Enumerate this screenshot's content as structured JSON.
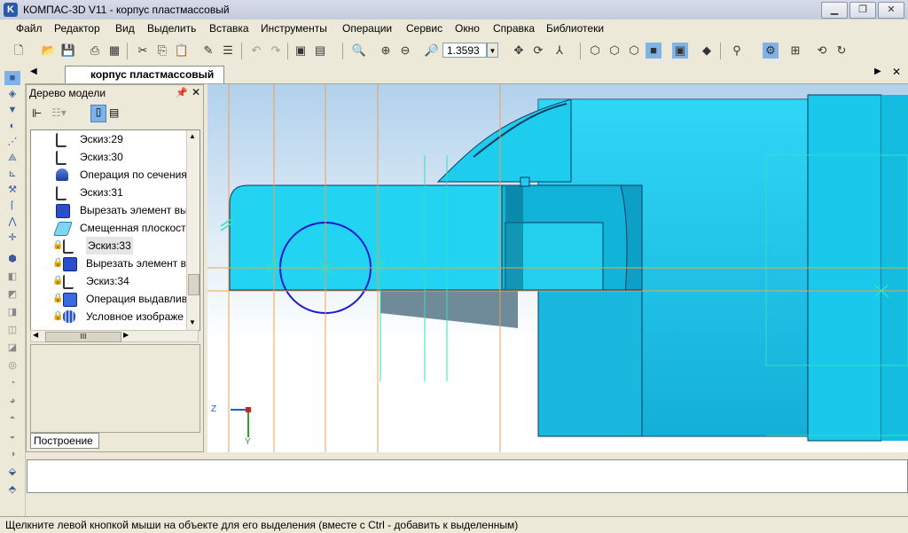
{
  "window": {
    "title": "КОМПАС-3D V11 - корпус пластмассовый",
    "app_icon": "K",
    "controls": [
      "minimize-icon",
      "restore-icon",
      "close-icon"
    ]
  },
  "menu": [
    "Файл",
    "Редактор",
    "Вид",
    "Выделить",
    "Вставка",
    "Инструменты",
    "Операции",
    "Сервис",
    "Окно",
    "Справка",
    "Библиотеки"
  ],
  "toolbar": {
    "zoom_value": "1.3593",
    "icons": [
      "new-document-icon",
      "open-icon",
      "save-icon",
      "print-preview-icon",
      "cut-icon",
      "copy-icon",
      "paste-icon",
      "properties-icon",
      "undo-icon",
      "redo-icon",
      "zoom-icon",
      "rotate-icon",
      "orient-icon",
      "wireframe-icon",
      "shaded-icon"
    ]
  },
  "document_tab": {
    "label": "корпус пластмассовый"
  },
  "tree": {
    "title": "Дерево модели",
    "items": [
      {
        "label": "Эскиз:29",
        "icon": "sketch-icon",
        "locked": false
      },
      {
        "label": "Эскиз:30",
        "icon": "sketch-icon",
        "locked": false
      },
      {
        "label": "Операция по сечения",
        "icon": "loft-icon",
        "locked": false
      },
      {
        "label": "Эскиз:31",
        "icon": "sketch-icon",
        "locked": false
      },
      {
        "label": "Вырезать элемент вы",
        "icon": "cut-extrude-icon",
        "locked": false
      },
      {
        "label": "Смещенная плоскост",
        "icon": "offset-plane-icon",
        "locked": false
      },
      {
        "label": "Эскиз:33",
        "icon": "sketch-icon",
        "locked": true
      },
      {
        "label": "Вырезать элемент в",
        "icon": "cut-extrude-icon",
        "locked": true
      },
      {
        "label": "Эскиз:34",
        "icon": "sketch-icon",
        "locked": true
      },
      {
        "label": "Операция выдавливе",
        "icon": "extrude-icon",
        "locked": true
      },
      {
        "label": "Условное изображе",
        "icon": "thread-icon",
        "locked": true
      }
    ],
    "bottom_tab": "Построение",
    "hscroll_label": "III"
  },
  "axes": {
    "z": "Z",
    "y": "Y"
  },
  "status": {
    "text": "Щелкните левой кнопкой мыши на объекте для его выделения (вместе с Ctrl - добавить к выделенным)"
  },
  "colors": {
    "part_fill": "#1bd3f0",
    "construction_line": "#f0a050",
    "circle": "#1a1ad0",
    "viewport_top": "#b2d1ec"
  }
}
